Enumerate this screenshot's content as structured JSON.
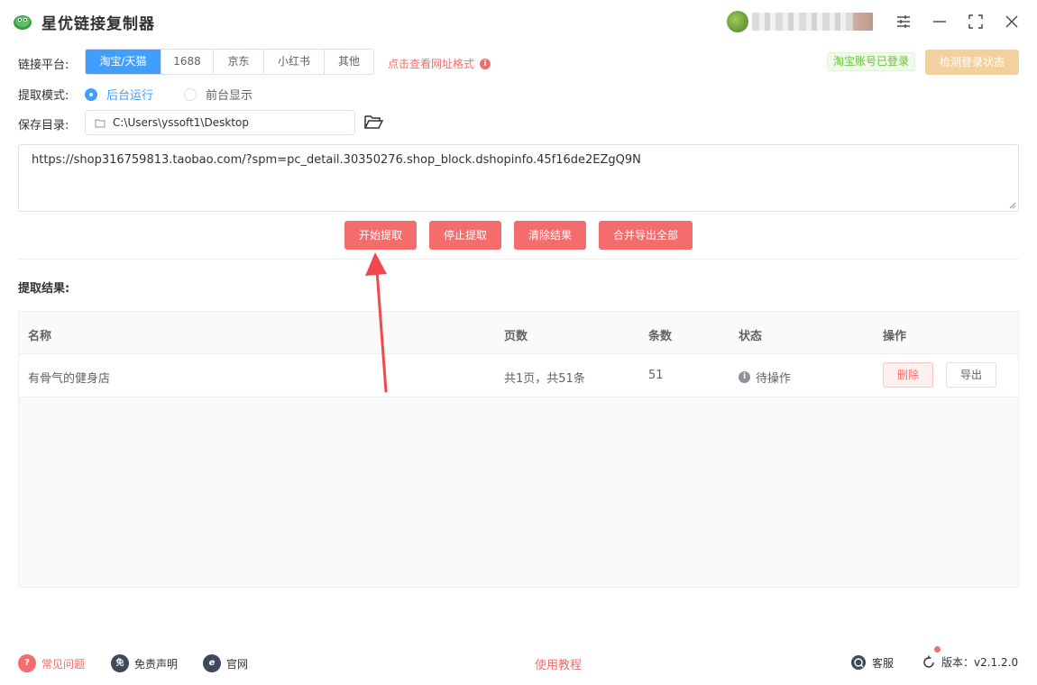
{
  "app": {
    "title": "星优链接复制器"
  },
  "platform": {
    "label": "链接平台:",
    "tabs": [
      "淘宝/天猫",
      "1688",
      "京东",
      "小红书",
      "其他"
    ],
    "help_link": "点击查看网址格式"
  },
  "login": {
    "status_tag": "淘宝账号已登录",
    "check_button": "检测登录状态"
  },
  "mode": {
    "label": "提取模式:",
    "options": [
      "后台运行",
      "前台显示"
    ],
    "selected": "后台运行"
  },
  "save_dir": {
    "label": "保存目录:",
    "value": "C:\\Users\\yssoft1\\Desktop"
  },
  "url_input": {
    "value": "https://shop316759813.taobao.com/?spm=pc_detail.30350276.shop_block.dshopinfo.45f16de2EZgQ9N"
  },
  "actions": [
    "开始提取",
    "停止提取",
    "清除结果",
    "合并导出全部"
  ],
  "results": {
    "title": "提取结果:",
    "columns": [
      "名称",
      "页数",
      "条数",
      "状态",
      "操作"
    ],
    "rows": [
      {
        "name": "有骨气的健身店",
        "pages": "共1页，共51条",
        "count": "51",
        "status": "待操作",
        "delete_label": "删除",
        "export_label": "导出"
      }
    ]
  },
  "footer": {
    "faq": "常见问题",
    "disclaimer": "免责声明",
    "website": "官网",
    "tutorial": "使用教程",
    "support": "客服",
    "version": "版本：v2.1.2.0"
  },
  "colors": {
    "primary": "#409eff",
    "danger": "#f56c6c",
    "success": "#67c23a",
    "warning_light": "#f3d19e"
  }
}
